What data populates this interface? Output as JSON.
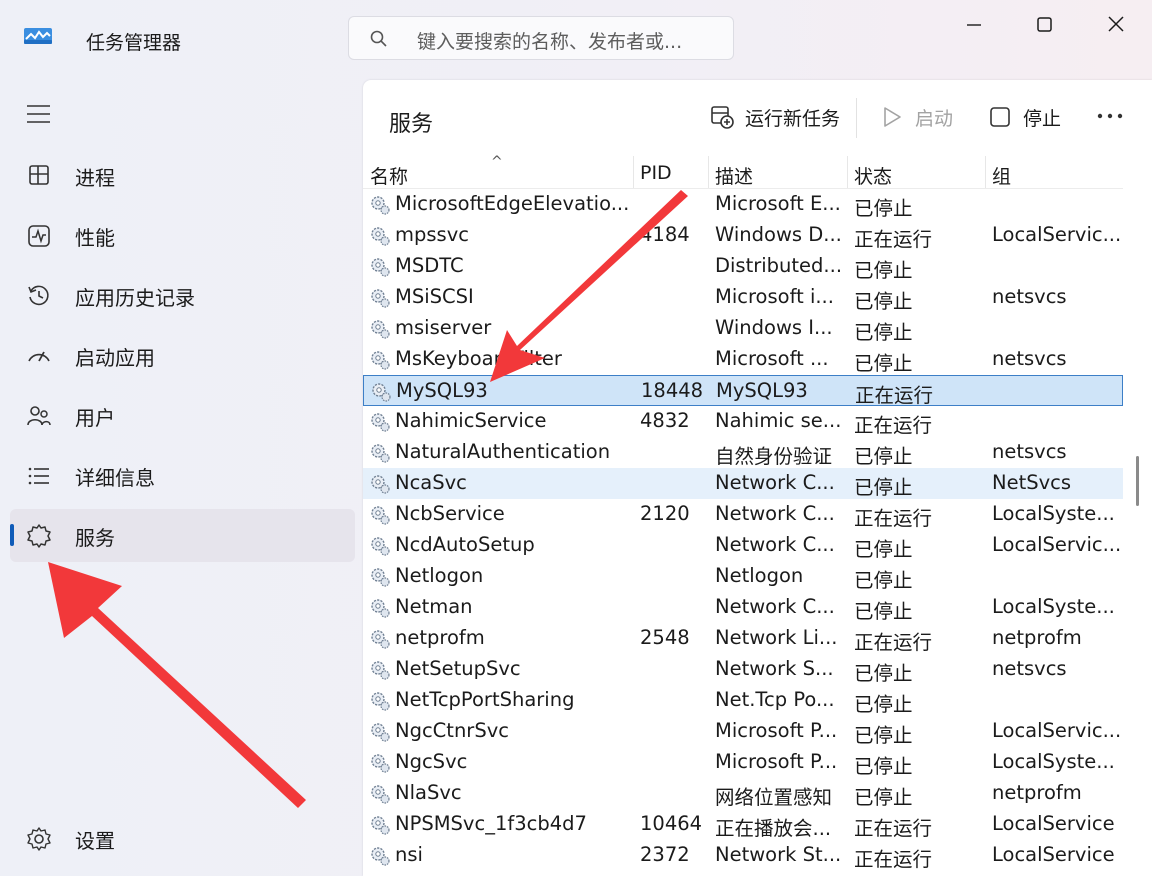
{
  "app": {
    "title": "任务管理器"
  },
  "search": {
    "placeholder": "键入要搜索的名称、发布者或..."
  },
  "sidebar": {
    "items": [
      {
        "label": "进程",
        "icon": "processes-icon"
      },
      {
        "label": "性能",
        "icon": "performance-icon"
      },
      {
        "label": "应用历史记录",
        "icon": "app-history-icon"
      },
      {
        "label": "启动应用",
        "icon": "startup-apps-icon"
      },
      {
        "label": "用户",
        "icon": "users-icon"
      },
      {
        "label": "详细信息",
        "icon": "details-icon"
      },
      {
        "label": "服务",
        "icon": "services-icon",
        "active": true
      }
    ],
    "settings_label": "设置"
  },
  "panel": {
    "title": "服务",
    "toolbar": {
      "run_new_task": "运行新任务",
      "start": "启动",
      "stop": "停止"
    }
  },
  "table": {
    "columns": [
      "名称",
      "PID",
      "描述",
      "状态",
      "组"
    ],
    "rows": [
      {
        "name": "MicrosoftEdgeElevatio...",
        "pid": "",
        "desc": "Microsoft E...",
        "status": "已停止",
        "group": ""
      },
      {
        "name": "mpssvc",
        "pid": "4184",
        "desc": "Windows D...",
        "status": "正在运行",
        "group": "LocalServic..."
      },
      {
        "name": "MSDTC",
        "pid": "",
        "desc": "Distributed...",
        "status": "已停止",
        "group": ""
      },
      {
        "name": "MSiSCSI",
        "pid": "",
        "desc": "Microsoft i...",
        "status": "已停止",
        "group": "netsvcs"
      },
      {
        "name": "msiserver",
        "pid": "",
        "desc": "Windows I...",
        "status": "已停止",
        "group": ""
      },
      {
        "name": "MsKeyboardFilter",
        "pid": "",
        "desc": "Microsoft ...",
        "status": "已停止",
        "group": "netsvcs"
      },
      {
        "name": "MySQL93",
        "pid": "18448",
        "desc": "MySQL93",
        "status": "正在运行",
        "group": "",
        "selected": true
      },
      {
        "name": "NahimicService",
        "pid": "4832",
        "desc": "Nahimic se...",
        "status": "正在运行",
        "group": ""
      },
      {
        "name": "NaturalAuthentication",
        "pid": "",
        "desc": "自然身份验证",
        "status": "已停止",
        "group": "netsvcs"
      },
      {
        "name": "NcaSvc",
        "pid": "",
        "desc": "Network C...",
        "status": "已停止",
        "group": "NetSvcs",
        "hover": true
      },
      {
        "name": "NcbService",
        "pid": "2120",
        "desc": "Network C...",
        "status": "正在运行",
        "group": "LocalSyste..."
      },
      {
        "name": "NcdAutoSetup",
        "pid": "",
        "desc": "Network C...",
        "status": "已停止",
        "group": "LocalServic..."
      },
      {
        "name": "Netlogon",
        "pid": "",
        "desc": "Netlogon",
        "status": "已停止",
        "group": ""
      },
      {
        "name": "Netman",
        "pid": "",
        "desc": "Network C...",
        "status": "已停止",
        "group": "LocalSyste..."
      },
      {
        "name": "netprofm",
        "pid": "2548",
        "desc": "Network Li...",
        "status": "正在运行",
        "group": "netprofm"
      },
      {
        "name": "NetSetupSvc",
        "pid": "",
        "desc": "Network S...",
        "status": "已停止",
        "group": "netsvcs"
      },
      {
        "name": "NetTcpPortSharing",
        "pid": "",
        "desc": "Net.Tcp Po...",
        "status": "已停止",
        "group": ""
      },
      {
        "name": "NgcCtnrSvc",
        "pid": "",
        "desc": "Microsoft P...",
        "status": "已停止",
        "group": "LocalServic..."
      },
      {
        "name": "NgcSvc",
        "pid": "",
        "desc": "Microsoft P...",
        "status": "已停止",
        "group": "LocalSyste..."
      },
      {
        "name": "NlaSvc",
        "pid": "",
        "desc": "网络位置感知",
        "status": "已停止",
        "group": "netprofm"
      },
      {
        "name": "NPSMSvc_1f3cb4d7",
        "pid": "10464",
        "desc": "正在播放会...",
        "status": "正在运行",
        "group": "LocalService"
      },
      {
        "name": "nsi",
        "pid": "2372",
        "desc": "Network St...",
        "status": "正在运行",
        "group": "LocalService"
      }
    ]
  },
  "colors": {
    "accent": "#0f5bb8",
    "annotation_arrow": "#f2383a",
    "selected_row": "#cfe4f8"
  }
}
